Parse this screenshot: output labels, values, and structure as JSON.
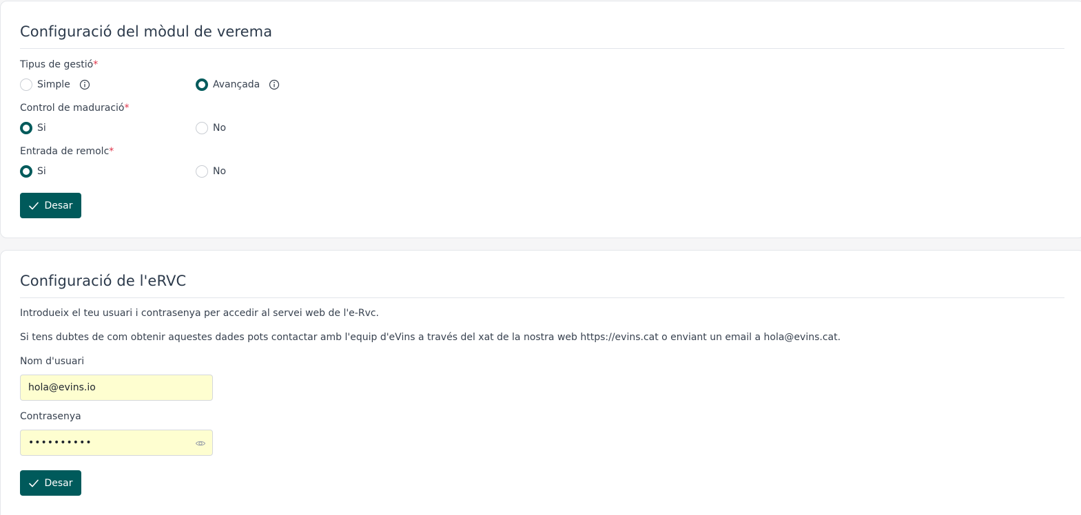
{
  "harvest_module": {
    "title": "Configuració del mòdul de verema",
    "management_type": {
      "label": "Tipus de gestió",
      "required_mark": "*",
      "options": [
        {
          "label": "Simple",
          "selected": false
        },
        {
          "label": "Avançada",
          "selected": true
        }
      ]
    },
    "maturation_control": {
      "label": "Control de maduració",
      "required_mark": "*",
      "options": [
        {
          "label": "Si",
          "selected": true
        },
        {
          "label": "No",
          "selected": false
        }
      ]
    },
    "trailer_entry": {
      "label": "Entrada de remolc",
      "required_mark": "*",
      "options": [
        {
          "label": "Si",
          "selected": true
        },
        {
          "label": "No",
          "selected": false
        }
      ]
    },
    "save_label": "Desar"
  },
  "ervc": {
    "title": "Configuració de l'eRVC",
    "intro": "Introdueix el teu usuari i contrasenya per accedir al servei web de l'e-Rvc.",
    "help": "Si tens dubtes de com obtenir aquestes dades pots contactar amb l'equip d'eVins a través del xat de la nostra web https://evins.cat o enviant un email a hola@evins.cat.",
    "username": {
      "label": "Nom d'usuari",
      "value": "hola@evins.io"
    },
    "password": {
      "label": "Contrasenya",
      "value": "••••••••••"
    },
    "save_label": "Desar"
  },
  "colors": {
    "accent": "#005a5b",
    "required": "#e0344a",
    "autofill": "#fefed0"
  },
  "icons": {
    "info": "info-icon",
    "check": "check-icon",
    "eye": "eye-icon"
  }
}
